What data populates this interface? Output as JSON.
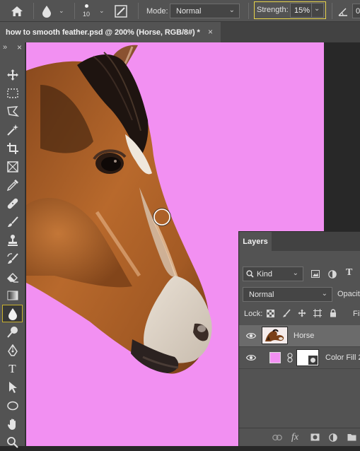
{
  "options_bar": {
    "brush_size": "10",
    "mode_label": "Mode:",
    "mode_value": "Normal",
    "strength_label": "Strength:",
    "strength_value": "15%",
    "angle_value": "0"
  },
  "document": {
    "tab_title": "how to smooth feather.psd @ 200% (Horse, RGB/8#) *",
    "close_glyph": "×",
    "canvas_fill": "#f290f2"
  },
  "toolbar": {
    "collapse_glyph": "»",
    "close_glyph": "×",
    "tools": [
      {
        "name": "move-tool",
        "icon": "move-icon"
      },
      {
        "name": "marquee-tool",
        "icon": "marquee-icon"
      },
      {
        "name": "lasso-tool",
        "icon": "polygonal-lasso-icon"
      },
      {
        "name": "magic-wand-tool",
        "icon": "magic-wand-icon"
      },
      {
        "name": "crop-tool",
        "icon": "crop-icon"
      },
      {
        "name": "frame-tool",
        "icon": "frame-icon"
      },
      {
        "name": "eyedropper-tool",
        "icon": "eyedropper-icon"
      },
      {
        "name": "healing-tool",
        "icon": "bandage-icon"
      },
      {
        "name": "brush-tool",
        "icon": "brush-icon"
      },
      {
        "name": "stamp-tool",
        "icon": "stamp-icon"
      },
      {
        "name": "history-brush-tool",
        "icon": "history-brush-icon"
      },
      {
        "name": "eraser-tool",
        "icon": "eraser-icon"
      },
      {
        "name": "gradient-tool",
        "icon": "gradient-icon"
      },
      {
        "name": "blur-tool",
        "icon": "water-drop-icon",
        "active": true
      },
      {
        "name": "dodge-tool",
        "icon": "dodge-icon"
      },
      {
        "name": "pen-tool",
        "icon": "pen-icon"
      },
      {
        "name": "type-tool",
        "icon": "type-icon",
        "glyph": "T"
      },
      {
        "name": "path-selection-tool",
        "icon": "arrow-icon"
      },
      {
        "name": "shape-tool",
        "icon": "ellipse-icon"
      },
      {
        "name": "hand-tool",
        "icon": "hand-icon"
      },
      {
        "name": "zoom-tool",
        "icon": "magnifier-icon"
      }
    ]
  },
  "layers_panel": {
    "tab_label": "Layers",
    "filter_value": "Kind",
    "type_filter_glyph": "T",
    "blend_mode": "Normal",
    "opacity_label": "Opacity",
    "lock_label": "Lock:",
    "fill_label": "Fil",
    "layers": [
      {
        "name": "Horse",
        "selected": true,
        "thumbnail": "horse-thumbnail"
      },
      {
        "name": "Color Fill 2",
        "selected": false,
        "swatch": "#f290f2"
      }
    ],
    "footer": {
      "link_glyph": "⊖",
      "fx_label": "fx"
    }
  }
}
